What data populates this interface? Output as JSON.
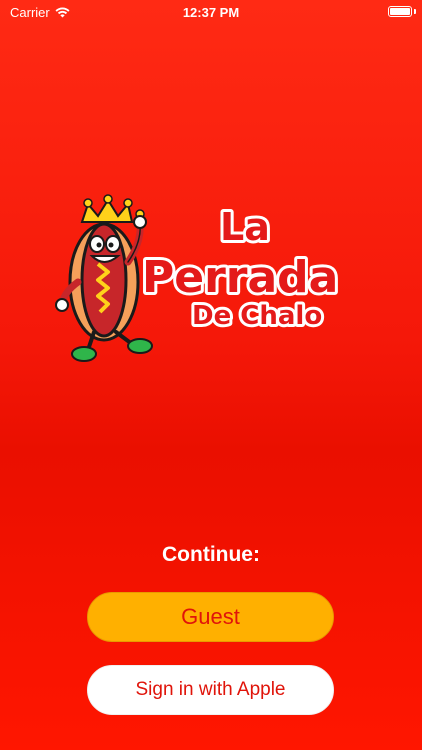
{
  "status_bar": {
    "carrier": "Carrier",
    "time": "12:37 PM",
    "wifi_icon": "wifi-icon",
    "battery_icon": "battery-icon"
  },
  "logo": {
    "line1": "La",
    "line2": "Perrada",
    "line3": "De Chalo",
    "mascot_icon": "hotdog-mascot-icon"
  },
  "auth": {
    "continue_label": "Continue:",
    "guest_label": "Guest",
    "apple_label": "Sign in with Apple"
  },
  "colors": {
    "background": "#f51809",
    "guest_button": "#ffb000",
    "button_text": "#e0140a",
    "apple_button": "#ffffff"
  }
}
